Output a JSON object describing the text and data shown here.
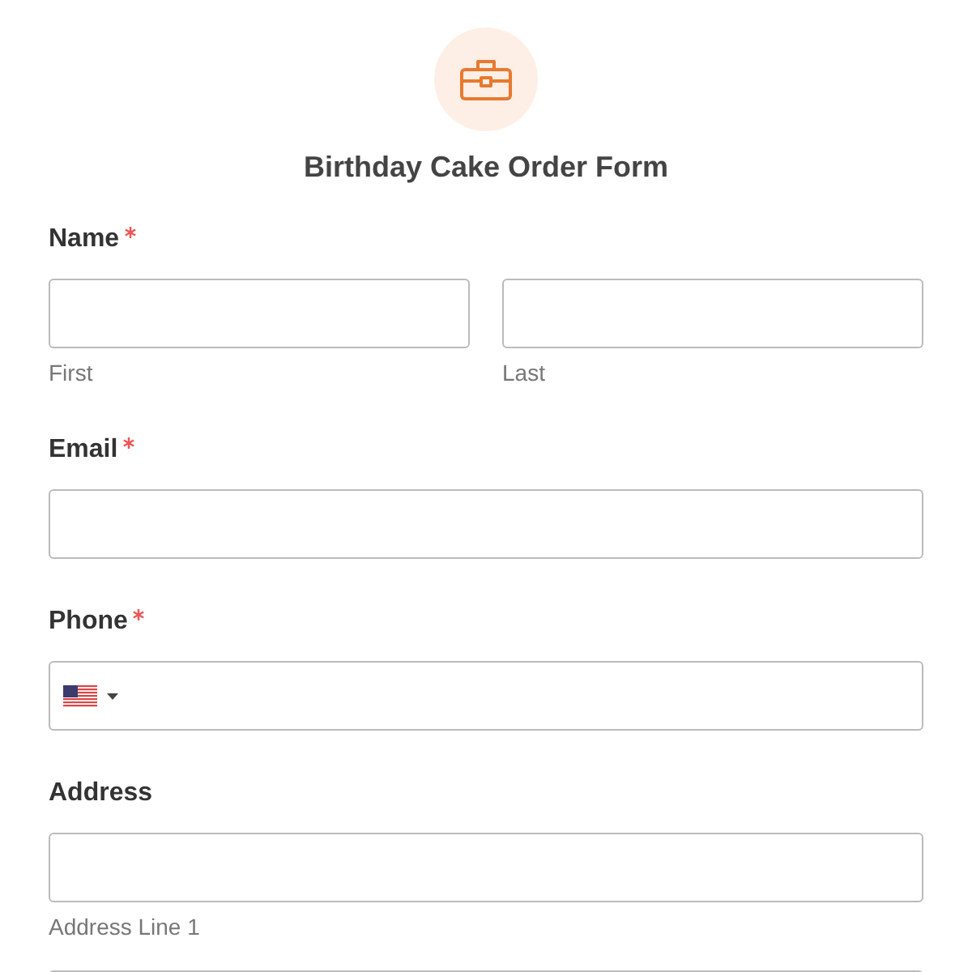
{
  "form": {
    "title": "Birthday Cake Order Form"
  },
  "fields": [
    {
      "label": "Name",
      "required": true,
      "inputs": [
        {
          "kind": "text",
          "sublabel": "First"
        },
        {
          "kind": "text",
          "sublabel": "Last"
        }
      ]
    },
    {
      "label": "Email",
      "required": true,
      "inputs": [
        {
          "kind": "text"
        }
      ]
    },
    {
      "label": "Phone",
      "required": true,
      "inputs": [
        {
          "kind": "phone"
        }
      ]
    },
    {
      "label": "Address",
      "required": false,
      "inputs": [
        {
          "kind": "text",
          "sublabel": "Address Line 1"
        },
        {
          "kind": "text"
        }
      ]
    }
  ]
}
